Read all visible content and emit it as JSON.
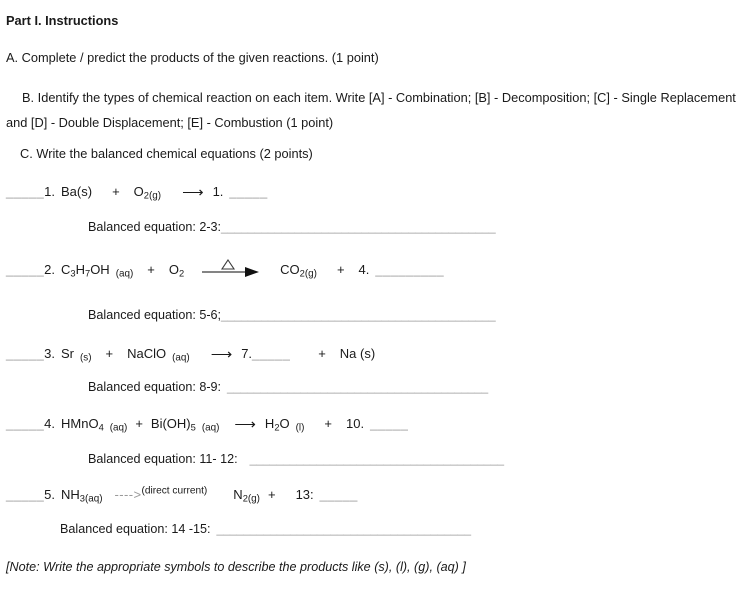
{
  "document": {
    "title": "Part I. Instructions",
    "instructions": [
      {
        "id": "instruction-a",
        "text": "A. Complete / predict the products of the given reactions. (1 point)"
      },
      {
        "id": "instruction-b",
        "text": "B. Identify the types of chemical reaction on each item. Write [A] - Combination; [B] -  Decomposition; [C] - Single Replacement and [D] - Double Displacement; [E] - Combustion (1 point)"
      },
      {
        "id": "instruction-c",
        "text": "C. Write the balanced chemical equations (2 points)"
      }
    ],
    "items": [
      {
        "number": "1.",
        "lead_blank": "_____",
        "reactant1": "Ba(s)",
        "reactant1_state": "",
        "plus1": "+",
        "reactant2": "O",
        "reactant2_sub": "2",
        "reactant2_state": "(g)",
        "arrow_type": "plain",
        "arrow_label": "",
        "product1_number": "1.",
        "product1_blank": "_____",
        "product2_plus": "",
        "product2": "",
        "product2_state": "",
        "balanced_label": "Balanced equation: 2-3:",
        "balanced_rule": "_________________________________________"
      },
      {
        "number": "2.",
        "lead_blank": "_____",
        "reactant1": "C",
        "reactant1_sub": "3",
        "reactant1_mid": "H",
        "reactant1_sub2": "7",
        "reactant1_end": "OH",
        "reactant1_state": "(aq)",
        "plus1": "+",
        "reactant2": "O",
        "reactant2_sub": "2",
        "reactant2_state": "",
        "arrow_type": "delta",
        "arrow_label": "△",
        "product1": "CO",
        "product1_sub": "2",
        "product1_state": "(g)",
        "product2_plus": "+",
        "product2_number": "4.",
        "product2_blank": "_________",
        "balanced_label": "Balanced equation: 5-6;",
        "balanced_rule": "_________________________________________"
      },
      {
        "number": "3.",
        "lead_blank": "_____",
        "reactant1": "Sr",
        "reactant1_state": "(s)",
        "plus1": "+",
        "reactant2": "NaClO",
        "reactant2_state": "(aq)",
        "arrow_type": "plain",
        "arrow_label": "",
        "product1_number": "7.",
        "product1_blank": "_____",
        "product2_plus": "+",
        "product2": "Na (s)",
        "balanced_label": "Balanced equation: 8-9:",
        "balanced_rule": "_______________________________________"
      },
      {
        "number": "4.",
        "lead_blank": "_____",
        "reactant1": "HMnO",
        "reactant1_sub": "4",
        "reactant1_state": "(aq)",
        "plus1": "+",
        "reactant2": "Bi(OH)",
        "reactant2_sub": "5",
        "reactant2_state": "(aq)",
        "arrow_type": "plain",
        "arrow_label": "",
        "product1": "H",
        "product1_sub": "2",
        "product1_end": "O",
        "product1_state": "(l)",
        "product2_plus": "+",
        "product2_number": "10.",
        "product2_blank": "_____",
        "balanced_label": "Balanced equation: 11- 12:",
        "balanced_rule": "______________________________________"
      },
      {
        "number": "5.",
        "lead_blank": "_____",
        "reactant1": "NH",
        "reactant1_sub": "3",
        "reactant1_state": "(aq)",
        "arrow_type": "text",
        "arrow_text": "---->",
        "arrow_sup": "(direct current)",
        "product1": "N",
        "product1_sub": "2",
        "product1_state": "(g)",
        "product2_plus": "+",
        "product2_number": "13:",
        "product2_blank": "_____",
        "balanced_label": "Balanced equation: 14 -15:",
        "balanced_rule": "______________________________________"
      }
    ],
    "footer_note": "[Note: Write the appropriate symbols to describe the products like (s), (l), (g), (aq) ]"
  },
  "colors": {
    "text": "#1a1a1a",
    "blank": "#9a9a9a",
    "background": "#ffffff"
  }
}
